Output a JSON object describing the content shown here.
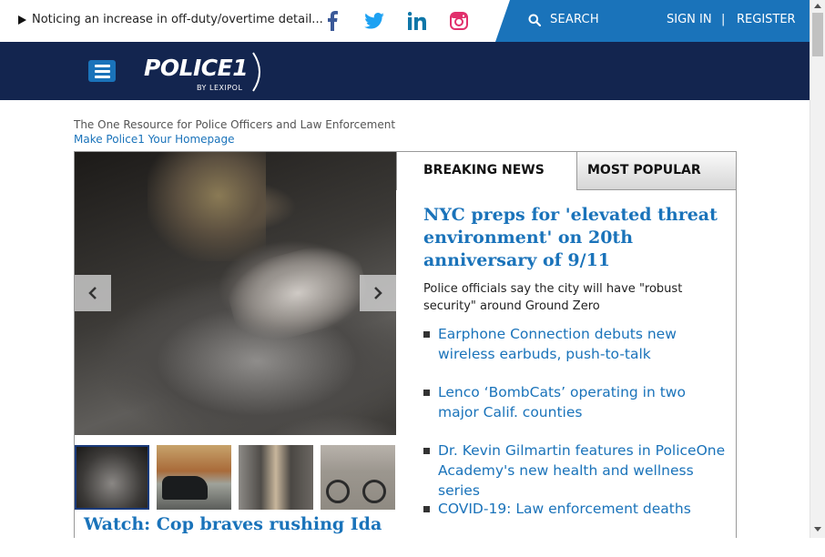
{
  "ticker": {
    "text": "Noticing an increase in off-duty/overtime detail..."
  },
  "social": {
    "facebook_color": "#3b5998",
    "twitter_color": "#1da1f2",
    "linkedin_color": "#0e76a8",
    "instagram_color": "#e1306c"
  },
  "header": {
    "search_label": "SEARCH",
    "sign_in_label": "SIGN IN",
    "separator": "|",
    "register_label": "REGISTER"
  },
  "logo": {
    "title": "POLICE1",
    "subtitle": "BY LEXIPOL"
  },
  "intro": {
    "tagline": "The One Resource for Police Officers and Law Enforcement",
    "homepage_link": "Make Police1 Your Homepage"
  },
  "hero": {
    "caption": "Watch: Cop braves rushing Ida"
  },
  "tabs": {
    "breaking": "BREAKING NEWS",
    "popular": "MOST POPULAR"
  },
  "main_story": {
    "headline": "NYC preps for 'elevated threat environment' on 20th anniversary of 9/11",
    "summary": "Police officials say the city will have \"robust security\" around Ground Zero"
  },
  "news_items": [
    {
      "text": "Earphone Connection debuts new wireless earbuds, push-to-talk"
    },
    {
      "text": "Lenco ‘BombCats’ operating in two major Calif. counties"
    },
    {
      "text": "Dr. Kevin Gilmartin features in PoliceOne Academy's new health and wellness series"
    },
    {
      "text": "COVID-19: Law enforcement deaths"
    }
  ],
  "colors": {
    "navy": "#13254f",
    "accent_blue": "#1a73ba"
  }
}
